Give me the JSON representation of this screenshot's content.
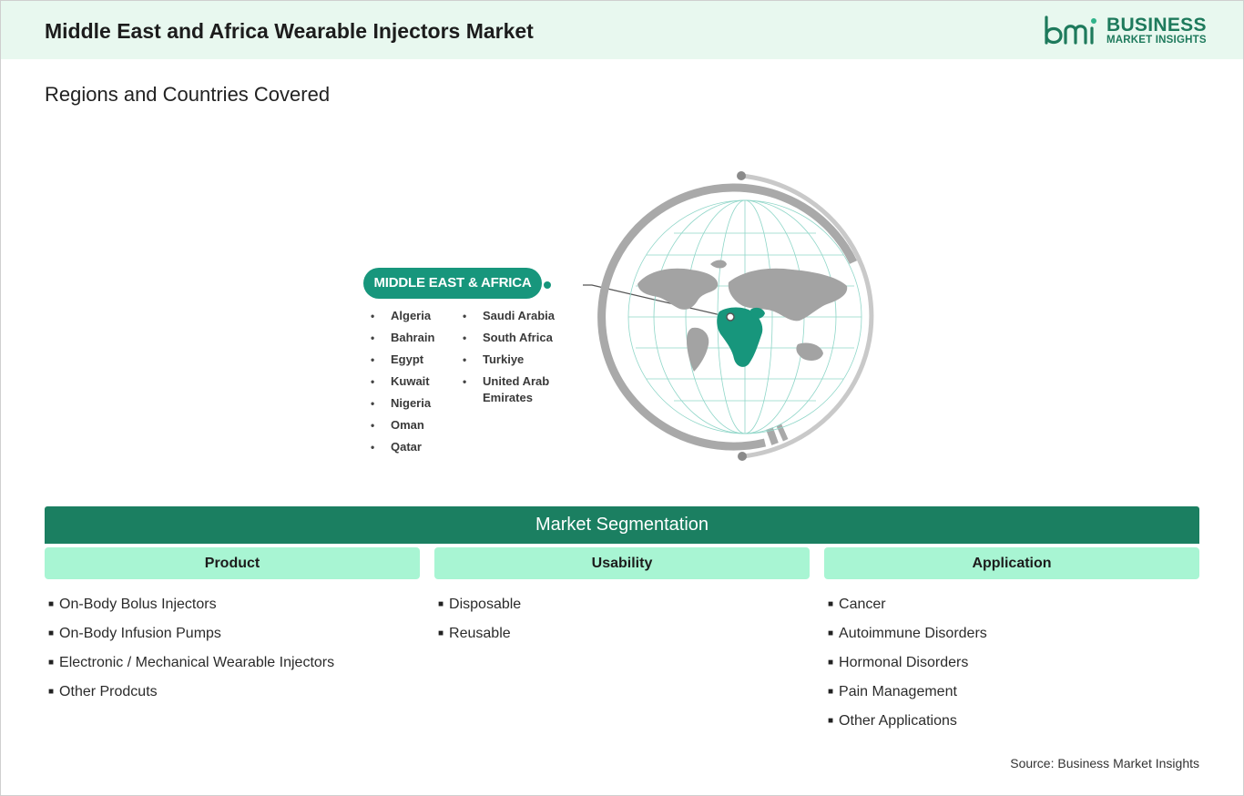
{
  "header": {
    "title": "Middle East and Africa Wearable Injectors Market",
    "logo": {
      "mark": "bmi",
      "line1": "BUSINESS",
      "line2": "MARKET INSIGHTS",
      "color": "#1e7a5c"
    }
  },
  "section_title": "Regions and Countries Covered",
  "region": {
    "label": "MIDDLE EAST & AFRICA",
    "color": "#17967c",
    "countries_left": [
      "Algeria",
      "Bahrain",
      "Egypt",
      "Kuwait",
      "Nigeria",
      "Oman",
      "Qatar"
    ],
    "countries_right": [
      "Saudi Arabia",
      "South Africa",
      "Turkiye",
      "United Arab Emirates"
    ]
  },
  "segmentation": {
    "title": "Market Segmentation",
    "banner_color": "#1b7f61",
    "header_color": "#a8f5d3",
    "columns": [
      {
        "heading": "Product",
        "items": [
          "On-Body Bolus Injectors",
          "On-Body Infusion Pumps",
          "Electronic / Mechanical Wearable Injectors",
          "Other Prodcuts"
        ]
      },
      {
        "heading": "Usability",
        "items": [
          "Disposable",
          "Reusable"
        ]
      },
      {
        "heading": "Application",
        "items": [
          "Cancer",
          "Autoimmune Disorders",
          "Hormonal Disorders",
          "Pain Management",
          "Other Applications"
        ]
      }
    ]
  },
  "source": "Source: Business Market Insights"
}
